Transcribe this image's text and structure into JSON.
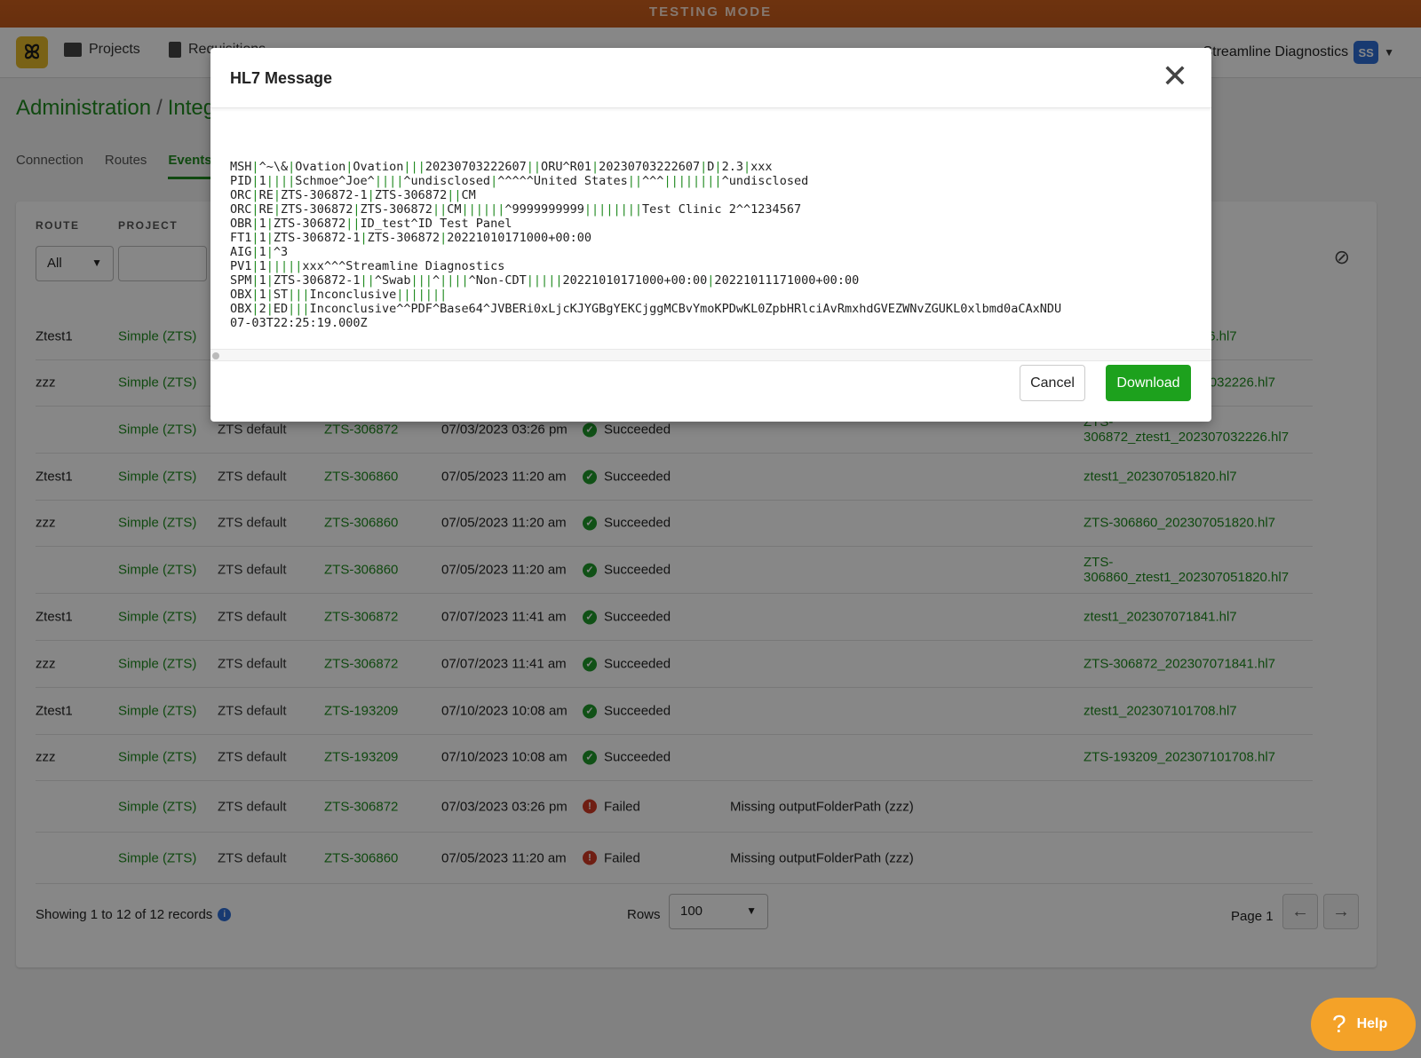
{
  "banner": "TESTING MODE",
  "nav": {
    "logo": "ꕤ",
    "items": [
      {
        "label": "Projects"
      },
      {
        "label": "Requisitions"
      }
    ],
    "org": "Streamline Diagnostics",
    "avatar": "SS"
  },
  "breadcrumb": {
    "root": "Administration",
    "sep": "/",
    "current": "Integrations"
  },
  "tabs": [
    {
      "label": "Connection"
    },
    {
      "label": "Routes"
    },
    {
      "label": "Events"
    }
  ],
  "filters": {
    "route_label": "ROUTE",
    "route_value": "All",
    "project_label": "PROJECT",
    "project_value": ""
  },
  "rows": [
    {
      "route": "Ztest1",
      "project": "Simple (ZTS)",
      "template": "",
      "id": "",
      "date": "",
      "status": "",
      "message": "",
      "file": "ztest1_202307032226.hl7"
    },
    {
      "route": "zzz",
      "project": "Simple (ZTS)",
      "template": "",
      "id": "",
      "date": "",
      "status": "",
      "message": "",
      "file": "ZTS-306872_202307032226.hl7"
    },
    {
      "route": "",
      "project": "Simple (ZTS)",
      "template": "ZTS default",
      "id": "ZTS-306872",
      "date": "07/03/2023 03:26 pm",
      "status": "Succeeded",
      "message": "",
      "file": "ZTS-306872_ztest1_202307032226.hl7"
    },
    {
      "route": "Ztest1",
      "project": "Simple (ZTS)",
      "template": "ZTS default",
      "id": "ZTS-306860",
      "date": "07/05/2023 11:20 am",
      "status": "Succeeded",
      "message": "",
      "file": "ztest1_202307051820.hl7"
    },
    {
      "route": "zzz",
      "project": "Simple (ZTS)",
      "template": "ZTS default",
      "id": "ZTS-306860",
      "date": "07/05/2023 11:20 am",
      "status": "Succeeded",
      "message": "",
      "file": "ZTS-306860_202307051820.hl7"
    },
    {
      "route": "",
      "project": "Simple (ZTS)",
      "template": "ZTS default",
      "id": "ZTS-306860",
      "date": "07/05/2023 11:20 am",
      "status": "Succeeded",
      "message": "",
      "file": "ZTS-306860_ztest1_202307051820.hl7"
    },
    {
      "route": "Ztest1",
      "project": "Simple (ZTS)",
      "template": "ZTS default",
      "id": "ZTS-306872",
      "date": "07/07/2023 11:41 am",
      "status": "Succeeded",
      "message": "",
      "file": "ztest1_202307071841.hl7"
    },
    {
      "route": "zzz",
      "project": "Simple (ZTS)",
      "template": "ZTS default",
      "id": "ZTS-306872",
      "date": "07/07/2023 11:41 am",
      "status": "Succeeded",
      "message": "",
      "file": "ZTS-306872_202307071841.hl7"
    },
    {
      "route": "Ztest1",
      "project": "Simple (ZTS)",
      "template": "ZTS default",
      "id": "ZTS-193209",
      "date": "07/10/2023 10:08 am",
      "status": "Succeeded",
      "message": "",
      "file": "ztest1_202307101708.hl7"
    },
    {
      "route": "zzz",
      "project": "Simple (ZTS)",
      "template": "ZTS default",
      "id": "ZTS-193209",
      "date": "07/10/2023 10:08 am",
      "status": "Succeeded",
      "message": "",
      "file": "ZTS-193209_202307101708.hl7"
    },
    {
      "route": "",
      "project": "Simple (ZTS)",
      "template": "ZTS default",
      "id": "ZTS-306872",
      "date": "07/03/2023 03:26 pm",
      "status": "Failed",
      "message": "Missing outputFolderPath (zzz)",
      "file": ""
    },
    {
      "route": "",
      "project": "Simple (ZTS)",
      "template": "ZTS default",
      "id": "ZTS-306860",
      "date": "07/05/2023 11:20 am",
      "status": "Failed",
      "message": "Missing outputFolderPath (zzz)",
      "file": ""
    }
  ],
  "footer": {
    "showing": "Showing 1 to 12 of 12 records",
    "rows_label": "Rows",
    "rows_value": "100",
    "page": "Page 1"
  },
  "help": {
    "label": "Help"
  },
  "modal": {
    "title": "HL7 Message",
    "close": "✕",
    "lines": [
      "MSH|^~\\&|Ovation|Ovation|||20230703222607||ORU^R01|20230703222607|D|2.3|xxx",
      "PID|1||||Schmoe^Joe^||||^undisclosed|^^^^^United States||^^^||||||||^undisclosed",
      "ORC|RE|ZTS-306872-1|ZTS-306872||CM",
      "ORC|RE|ZTS-306872|ZTS-306872||CM||||||^9999999999||||||||Test Clinic 2^^1234567",
      "OBR|1|ZTS-306872||ID_test^ID Test Panel",
      "FT1|1|ZTS-306872-1|ZTS-306872|20221010171000+00:00",
      "AIG|1|^3",
      "PV1|1|||||xxx^^^Streamline Diagnostics",
      "SPM|1|ZTS-306872-1||^Swab|||^||||^Non-CDT|||||20221010171000+00:00|20221011171000+00:00",
      "OBX|1|ST|||Inconclusive|||||||",
      "OBX|2|ED|||Inconclusive^^PDF^Base64^JVBERi0xLjcKJYGBgYEKCjggMCBvYmoKPDwKL0ZpbHRlciAvRmxhdGVEZWNvZGUKL0xlbmd0aCAxNDU",
      "07-03T22:25:19.000Z"
    ],
    "cancel": "Cancel",
    "download": "Download"
  },
  "colors": {
    "accent": "#1f8a1f",
    "banner": "#c45a1c",
    "download": "#1da11d",
    "help": "#f4a228"
  }
}
